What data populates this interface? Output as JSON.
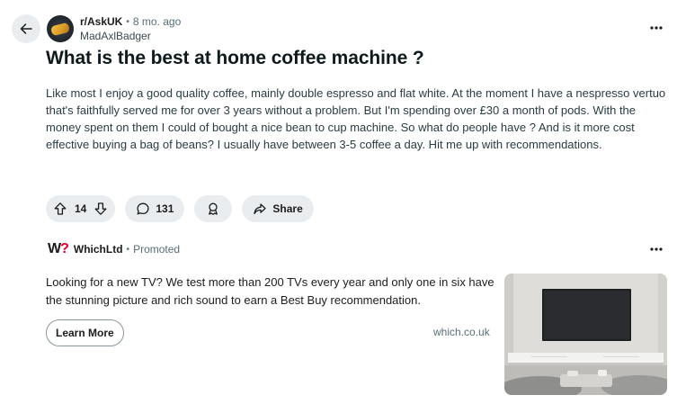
{
  "post": {
    "subreddit": "r/AskUK",
    "age": "8 mo. ago",
    "author": "MadAxlBadger",
    "separator": "•",
    "title": "What is the best at home coffee machine ?",
    "body": "Like most I enjoy a good quality coffee, mainly double espresso and flat white. At the moment I have a nespresso vertuo that's faithfully served me for over 3 years without a problem. But I'm spending over £30 a month of pods. With the money spent on them I could of bought a nice bean to cup machine. So what do people have ? And is it more cost effective buying a bag of beans? I usually have between 3-5 coffee a day. Hit me up with recommendations."
  },
  "actions": {
    "votes": "14",
    "comments": "131",
    "share_label": "Share"
  },
  "promo": {
    "logo_main": "W",
    "logo_accent": "?",
    "advertiser": "WhichLtd",
    "separator": "•",
    "promoted_label": "Promoted",
    "text": "Looking for a new TV? We test more than 200 TVs every year and only one in six have the stunning picture and rich sound to earn a Best Buy recommendation.",
    "cta_label": "Learn More",
    "domain": "which.co.uk"
  },
  "icons": {
    "back": "arrow-left-icon",
    "more": "ellipsis-icon",
    "upvote": "arrow-up-icon",
    "downvote": "arrow-down-icon",
    "comment": "speech-bubble-icon",
    "award": "award-icon",
    "share": "share-arrow-icon"
  },
  "colors": {
    "pill_bg": "#eaedef",
    "muted_text": "#576f76",
    "which_red": "#e4002b"
  }
}
